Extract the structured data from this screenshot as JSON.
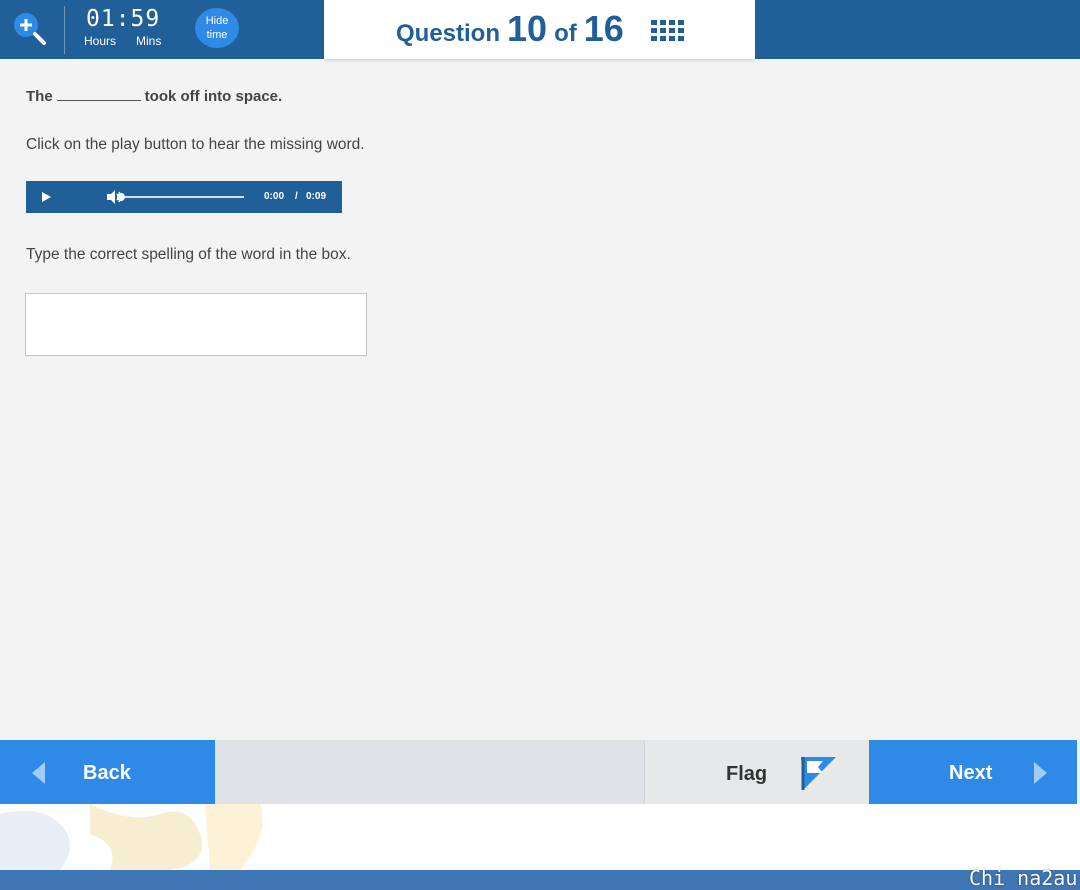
{
  "header": {
    "timer": {
      "value": "01:59",
      "hours_label": "Hours",
      "mins_label": "Mins"
    },
    "hide_time_label": "Hide\ntime",
    "question": {
      "prefix": "Question",
      "current": "10",
      "of": "of",
      "total": "16"
    }
  },
  "content": {
    "sentence_before": "The",
    "sentence_after": "took off into space.",
    "instruction_audio": "Click on the play button to hear the missing word.",
    "player": {
      "current_time": "0:00",
      "separator": "/",
      "duration": "0:09",
      "progress": 0
    },
    "instruction_type": "Type the correct spelling of the word in the box.",
    "answer_value": ""
  },
  "nav": {
    "back_label": "Back",
    "flag_label": "Flag",
    "next_label": "Next"
  },
  "watermark": "Chi na2au",
  "colors": {
    "header_blue": "#215f98",
    "button_blue": "#2e8ae6",
    "background": "#f3f3f3"
  },
  "icons": {
    "zoom": "zoom-in-icon",
    "grid": "question-grid-icon",
    "play": "play-icon",
    "volume": "volume-icon",
    "back": "chevron-left-icon",
    "flag": "flag-icon",
    "next": "chevron-right-icon"
  }
}
